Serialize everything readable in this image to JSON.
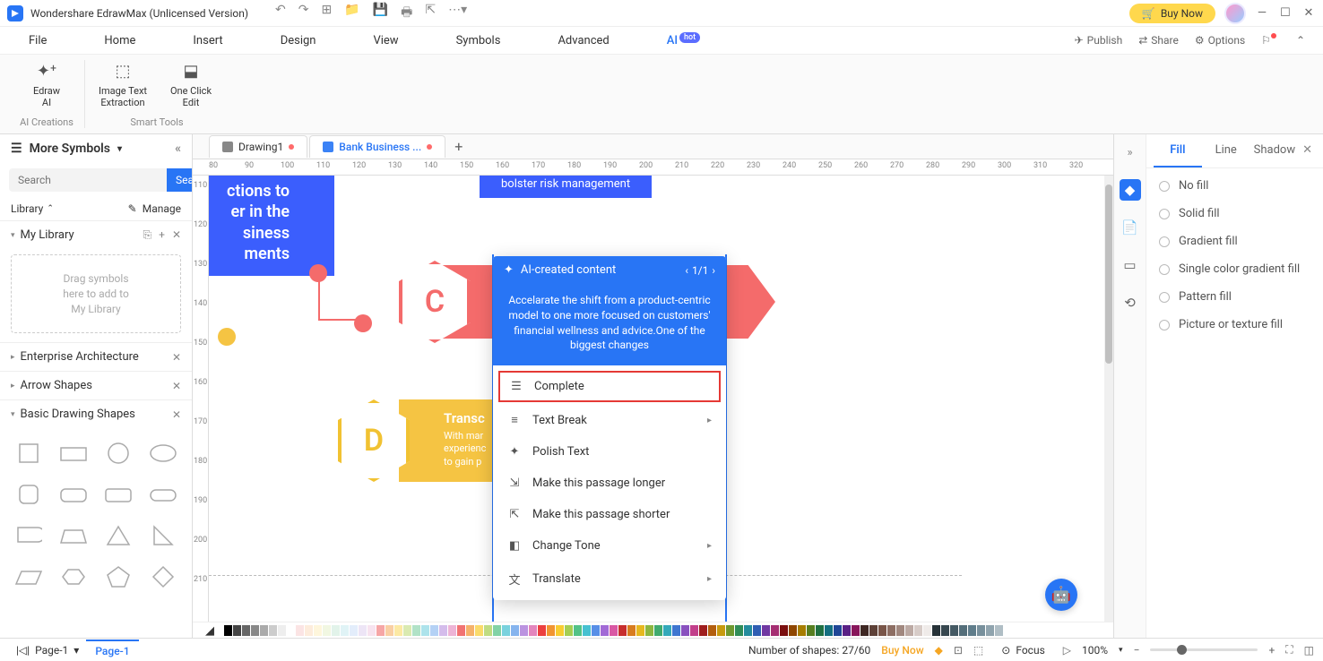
{
  "titlebar": {
    "app_title": "Wondershare EdrawMax (Unlicensed Version)",
    "buy_now": "Buy Now"
  },
  "menubar": {
    "items": [
      "File",
      "Home",
      "Insert",
      "Design",
      "View",
      "Symbols",
      "Advanced",
      "AI"
    ],
    "hot": "hot",
    "publish": "Publish",
    "share": "Share",
    "options": "Options"
  },
  "ribbon": {
    "groups": [
      {
        "label": "AI Creations",
        "buttons": [
          {
            "label": "Edraw\nAI"
          }
        ]
      },
      {
        "label": "Smart Tools",
        "buttons": [
          {
            "label": "Image Text\nExtraction"
          },
          {
            "label": "One Click\nEdit"
          }
        ]
      }
    ]
  },
  "left_panel": {
    "header": "More Symbols",
    "search_placeholder": "Search",
    "search_btn": "Search",
    "library": "Library",
    "manage": "Manage",
    "sections": {
      "my_library": "My Library",
      "drop_hint": "Drag symbols\nhere to add to\nMy Library",
      "enterprise": "Enterprise Architecture",
      "arrow": "Arrow Shapes",
      "basic": "Basic Drawing Shapes"
    }
  },
  "doc_tabs": {
    "tab1": "Drawing1",
    "tab2": "Bank Business ..."
  },
  "ruler_h": [
    80,
    90,
    100,
    110,
    120,
    130,
    140,
    150,
    160,
    170,
    180,
    190,
    200,
    210,
    220,
    230,
    240,
    250,
    260,
    270,
    280,
    290,
    300,
    310,
    320
  ],
  "ruler_v": [
    110,
    120,
    130,
    140,
    150,
    160,
    170,
    180,
    190,
    200,
    210
  ],
  "canvas": {
    "blue_arrow1": "ctions to\ner in the\nsiness\nments",
    "blue_arrow2": "bolster risk management",
    "hex_c": "C",
    "hex_d": "D",
    "yellow_title": "Transc",
    "yellow_body": "With mar\nexperienc\nto gain p"
  },
  "ai_popup": {
    "title": "AI-created content",
    "pager": "1/1",
    "body": "Accelarate the shift from a product-centric model to one more focused on customers' financial wellness and advice.One of the biggest changes",
    "menu": {
      "complete": "Complete",
      "text_break": "Text Break",
      "polish": "Polish Text",
      "longer": "Make this passage longer",
      "shorter": "Make this passage shorter",
      "tone": "Change Tone",
      "translate": "Translate"
    }
  },
  "right_panel": {
    "tabs": {
      "fill": "Fill",
      "line": "Line",
      "shadow": "Shadow"
    },
    "options": {
      "no_fill": "No fill",
      "solid": "Solid fill",
      "gradient": "Gradient fill",
      "single_grad": "Single color gradient fill",
      "pattern": "Pattern fill",
      "picture": "Picture or texture fill"
    }
  },
  "statusbar": {
    "page": "Page-1",
    "page_tab": "Page-1",
    "shapes_label": "Number of shapes:",
    "shapes_count": "27/60",
    "buy_now": "Buy Now",
    "focus": "Focus",
    "zoom": "100%"
  },
  "colors": [
    "#000",
    "#444",
    "#666",
    "#888",
    "#aaa",
    "#ccc",
    "#eee",
    "#fff",
    "#fbe4e4",
    "#fdecdc",
    "#fef6dc",
    "#f1f7e2",
    "#e2f3ea",
    "#e0f3f6",
    "#e3edfb",
    "#ede5f6",
    "#f7e3ef",
    "#f6a6a6",
    "#f9cfa4",
    "#fce9a4",
    "#daeab1",
    "#b1e2c7",
    "#ade3eb",
    "#b4d1f5",
    "#d4bceb",
    "#edb4d6",
    "#f17373",
    "#f5b26b",
    "#fadb6b",
    "#c0dc82",
    "#82d2a6",
    "#7ad2de",
    "#86b4ee",
    "#bb93e0",
    "#e386bd",
    "#ec4040",
    "#f19532",
    "#f8cd32",
    "#a6ce53",
    "#53c287",
    "#47c1d1",
    "#588fe7",
    "#a26ad6",
    "#d958a4",
    "#c72e2e",
    "#d87c1f",
    "#e6b81f",
    "#8cb640",
    "#40aa6e",
    "#34a9ba",
    "#3f76d0",
    "#8951bf",
    "#c23f8b",
    "#9f1e1e",
    "#b35f0f",
    "#c79a0f",
    "#6f9930",
    "#308d58",
    "#248c9d",
    "#2f5eb3",
    "#7038a2",
    "#a52e72",
    "#7a0e0e",
    "#8f4600",
    "#a77d00",
    "#577e20",
    "#207042",
    "#146f80",
    "#1f4696",
    "#5a2085",
    "#88165b",
    "#3e2723",
    "#5d4037",
    "#795548",
    "#8d6e63",
    "#a1887f",
    "#bcaaa4",
    "#d7ccc8",
    "#efebe9",
    "#263238",
    "#37474f",
    "#455a64",
    "#546e7a",
    "#607d8b",
    "#78909c",
    "#90a4ae",
    "#b0bec5"
  ]
}
